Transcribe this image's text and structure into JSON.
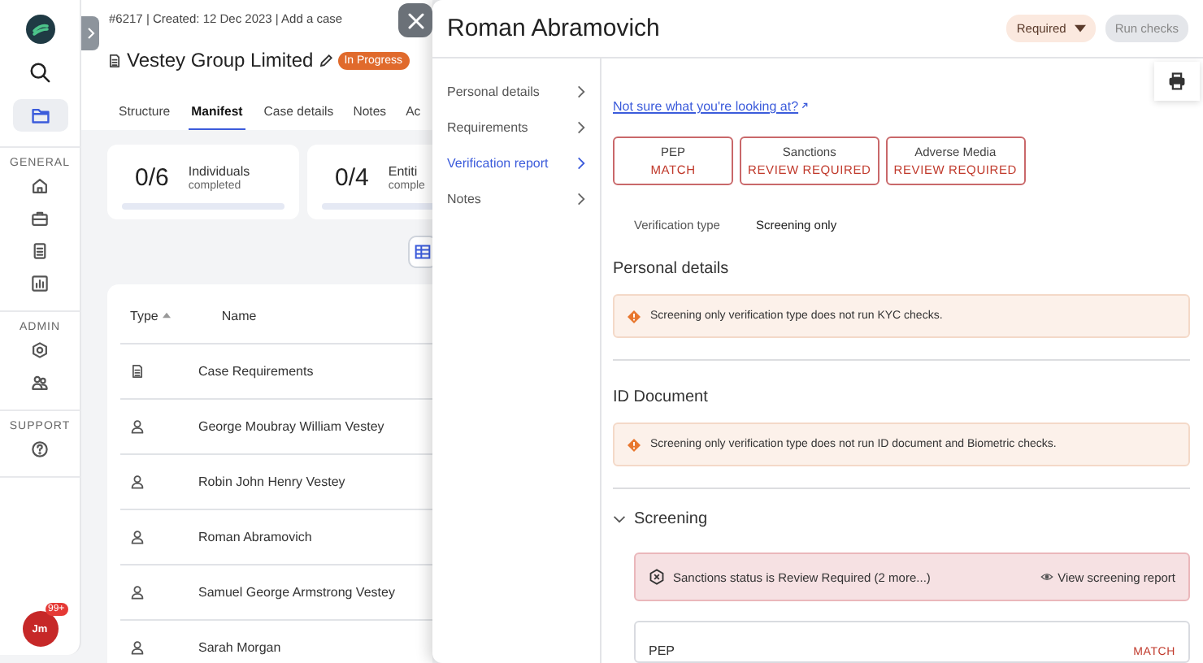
{
  "sidebar": {
    "top": [
      {
        "kind": "logo",
        "selected": false
      },
      {
        "kind": "search",
        "selected": false
      },
      {
        "kind": "folder",
        "selected": true
      }
    ],
    "sections": [
      {
        "label": "GENERAL",
        "items": [
          {
            "kind": "home"
          },
          {
            "kind": "briefcase"
          },
          {
            "kind": "document"
          },
          {
            "kind": "chart"
          }
        ]
      },
      {
        "label": "ADMIN",
        "items": [
          {
            "kind": "gear"
          },
          {
            "kind": "users"
          }
        ]
      },
      {
        "label": "SUPPORT",
        "items": [
          {
            "kind": "help"
          }
        ]
      }
    ],
    "avatar": {
      "initials": "Jm",
      "badge": "99+"
    }
  },
  "case": {
    "meta": "#6217 | Created: 12 Dec 2023 | Add a case",
    "title": "Vestey Group Limited",
    "status": "In Progress",
    "tabs": [
      {
        "label": "Structure",
        "selected": false
      },
      {
        "label": "Manifest",
        "selected": true
      },
      {
        "label": "Case details",
        "selected": false
      },
      {
        "label": "Notes",
        "selected": false
      },
      {
        "label": "Ac",
        "selected": false
      }
    ],
    "stats": [
      {
        "value": "0/6",
        "label": "Individuals",
        "sub": "completed",
        "level": 0
      },
      {
        "value": "0/4",
        "label": "Entiti",
        "sub": "comple",
        "level": 0
      }
    ],
    "table": {
      "columns": [
        "Type",
        "Name"
      ],
      "rows": [
        {
          "kind": "document",
          "name": "Case Requirements"
        },
        {
          "kind": "person",
          "name": "George Moubray William Vestey"
        },
        {
          "kind": "person",
          "name": "Robin John Henry Vestey"
        },
        {
          "kind": "person",
          "name": "Roman Abramovich"
        },
        {
          "kind": "person",
          "name": "Samuel George Armstrong Vestey"
        },
        {
          "kind": "person",
          "name": "Sarah Morgan"
        }
      ]
    }
  },
  "drawer": {
    "title": "Roman Abramovich",
    "status": "Required",
    "run_button": {
      "label": "Run checks",
      "disabled": true
    },
    "nav": [
      {
        "label": "Personal details",
        "selected": false
      },
      {
        "label": "Requirements",
        "selected": false
      },
      {
        "label": "Verification report",
        "selected": true
      },
      {
        "label": "Notes",
        "selected": false
      }
    ],
    "help_link": "Not sure what you're looking at?",
    "results": [
      {
        "name": "PEP",
        "result": "MATCH"
      },
      {
        "name": "Sanctions",
        "result": "REVIEW REQUIRED"
      },
      {
        "name": "Adverse Media",
        "result": "REVIEW REQUIRED"
      }
    ],
    "verification": {
      "label": "Verification type",
      "value": "Screening only"
    },
    "sections": [
      {
        "kind": "notice",
        "title": "Personal details",
        "message": "Screening only verification type does not run KYC checks."
      },
      {
        "kind": "notice",
        "title": "ID Document",
        "message": "Screening only verification type does not run ID document and Biometric checks."
      },
      {
        "kind": "screening",
        "title": "Screening",
        "expanded": true,
        "alert": "Sanctions status is Review Required (2 more...)",
        "alert_link": "View screening report",
        "checks": [
          {
            "name": "PEP",
            "result": "MATCH"
          }
        ]
      }
    ]
  }
}
